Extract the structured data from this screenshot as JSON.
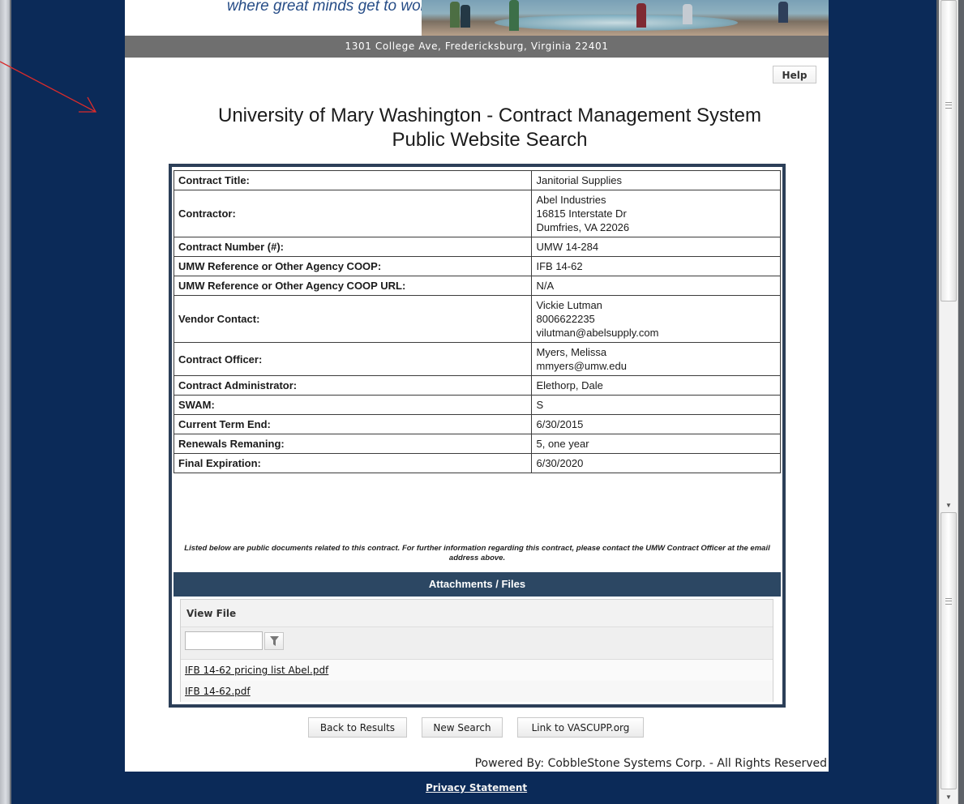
{
  "banner": {
    "tagline": "where great minds get to work",
    "address": "1301 College Ave, Fredericksburg, Virginia 22401"
  },
  "header": {
    "help_label": "Help",
    "title_line1": "University of Mary Washington - Contract Management System",
    "title_line2": "Public Website Search"
  },
  "contract": {
    "rows": [
      {
        "label": "Contract Title:",
        "value": "Janitorial Supplies"
      },
      {
        "label": "Contractor:",
        "value_lines": [
          "Abel Industries",
          "16815 Interstate Dr",
          "Dumfries,  VA  22026"
        ]
      },
      {
        "label": "Contract Number (#):",
        "value": "UMW 14-284"
      },
      {
        "label": "UMW Reference or Other Agency COOP:",
        "value": "IFB 14-62"
      },
      {
        "label": "UMW Reference or Other Agency COOP URL:",
        "value": "N/A"
      },
      {
        "label": "Vendor Contact:",
        "value_lines": [
          "Vickie Lutman",
          "8006622235",
          "vilutman@abelsupply.com"
        ]
      },
      {
        "label": "Contract Officer:",
        "value_lines": [
          "Myers, Melissa",
          "mmyers@umw.edu"
        ]
      },
      {
        "label": "Contract Administrator:",
        "value": "Elethorp, Dale"
      },
      {
        "label": "SWAM:",
        "value": "S"
      },
      {
        "label": "Current Term End:",
        "value": "6/30/2015"
      },
      {
        "label": "Renewals Remaning:",
        "value": "5, one year"
      },
      {
        "label": "Final Expiration:",
        "value": "6/30/2020"
      }
    ],
    "note": "Listed below are public documents related to this contract. For further information regarding this contract, please contact the UMW Contract Officer at the email address above."
  },
  "attachments": {
    "header": "Attachments / Files",
    "column": "View File",
    "filter_value": "",
    "files": [
      "IFB 14-62 pricing list Abel.pdf",
      "IFB 14-62.pdf"
    ]
  },
  "actions": {
    "back": "Back to Results",
    "new_search": "New Search",
    "link": "Link to VASCUPP.org"
  },
  "footer": {
    "powered": "Powered By: CobbleStone Systems Corp. - All Rights Reserved",
    "privacy": "Privacy Statement"
  },
  "colors": {
    "background": "#0b2a58",
    "header_blue": "#2c4763",
    "annotation_red": "#d92b2b"
  },
  "icons": {
    "filter": "filter-icon",
    "scroll_up": "triangle-up",
    "scroll_down": "triangle-down"
  }
}
